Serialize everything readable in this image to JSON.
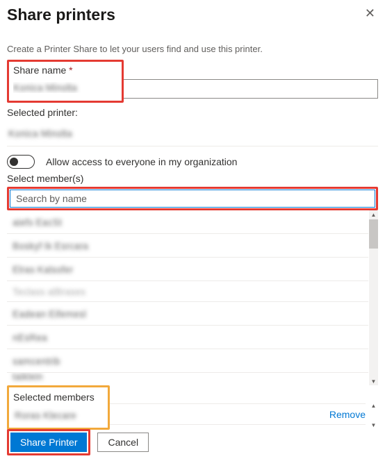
{
  "header": {
    "title": "Share printers"
  },
  "description": "Create a Printer Share to let your users find and use this printer.",
  "shareName": {
    "label": "Share name",
    "required": "*",
    "value": "Konica Minolta"
  },
  "selectedPrinter": {
    "label": "Selected printer:",
    "value": "Konica Minolta"
  },
  "accessToggle": {
    "label": "Allow access to everyone in my organization"
  },
  "selectMembers": {
    "label": "Select member(s)",
    "searchPlaceholder": "Search by name",
    "items": [
      "aiefs EacSt",
      "Boskyf Ik Esrcara",
      "Elras Kalsofer",
      "Teclass alBrases",
      "Eadean Eifemesl",
      "nEsRea",
      "samcentrib",
      "taiklein"
    ]
  },
  "selectedMembers": {
    "label": "Selected members",
    "items": [
      {
        "name": "Roras Klecare",
        "removeLabel": "Remove"
      }
    ]
  },
  "footer": {
    "primary": "Share Printer",
    "secondary": "Cancel"
  }
}
